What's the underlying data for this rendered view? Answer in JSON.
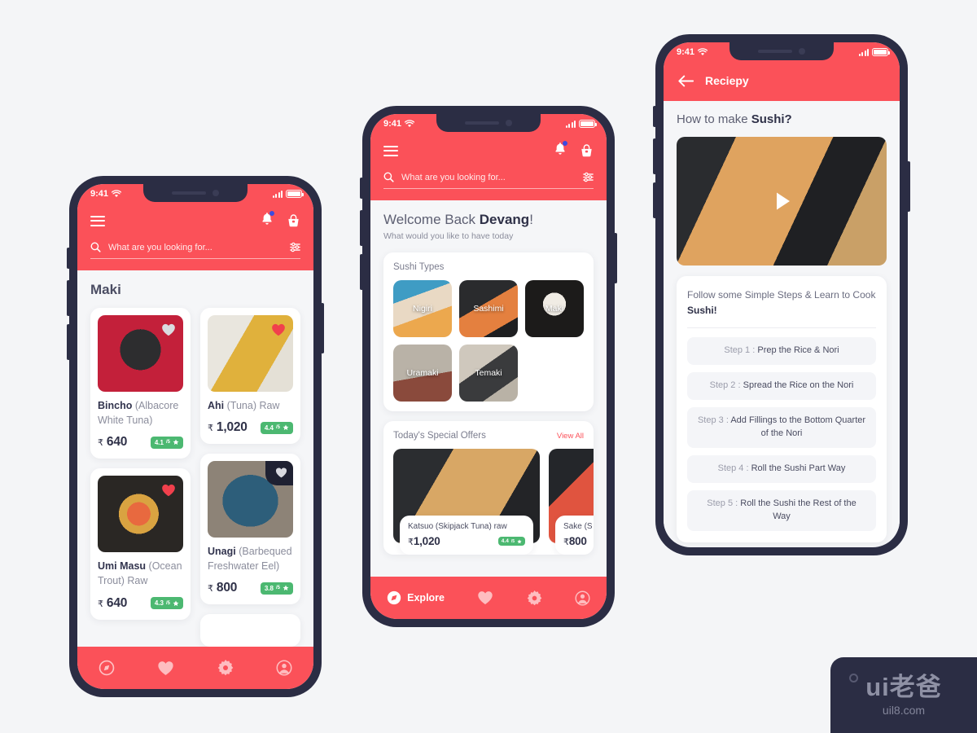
{
  "theme": {
    "accent": "#fb5159",
    "frame": "#2b2d44",
    "bg": "#f5f6f8",
    "rating_green": "#4cb871"
  },
  "status_bar": {
    "time": "9:41"
  },
  "search": {
    "placeholder": "What are you looking for..."
  },
  "phone1": {
    "section_title": "Maki",
    "products": [
      {
        "name": "Bincho",
        "desc": "(Albacore White Tuna)",
        "currency": "₹",
        "price": "640",
        "rating": "4.1",
        "rating_suffix": "/5",
        "favorite": false
      },
      {
        "name": "Ahi",
        "desc": "(Tuna) Raw",
        "currency": "₹",
        "price": "1,020",
        "rating": "4.4",
        "rating_suffix": "/5",
        "favorite": true
      },
      {
        "name": "Umi Masu",
        "desc": "(Ocean Trout) Raw",
        "currency": "₹",
        "price": "640",
        "rating": "4.3",
        "rating_suffix": "/5",
        "favorite": true
      },
      {
        "name": "Unagi",
        "desc": "(Barbequed Freshwater Eel)",
        "currency": "₹",
        "price": "800",
        "rating": "3.8",
        "rating_suffix": "/5",
        "favorite": false
      }
    ],
    "nav": [
      {
        "icon": "compass-icon",
        "label": "",
        "active": true
      },
      {
        "icon": "heart-icon",
        "label": "",
        "active": false
      },
      {
        "icon": "gear-icon",
        "label": "",
        "active": false
      },
      {
        "icon": "account-icon",
        "label": "",
        "active": false
      }
    ]
  },
  "phone2": {
    "welcome_prefix": "Welcome Back ",
    "welcome_name": "Devang",
    "welcome_suffix": "!",
    "welcome_sub": "What would you like to have today",
    "types_title": "Sushi Types",
    "types": [
      "Nigiri",
      "Sashimi",
      "Maki",
      "Uramaki",
      "Temaki"
    ],
    "offers_title": "Today's Special Offers",
    "offers_viewall": "View All",
    "offers": [
      {
        "name": "Katsuo (Skipjack Tuna) raw",
        "currency": "₹",
        "price": "1,020",
        "rating": "4.4",
        "rating_suffix": "/5"
      },
      {
        "name": "Sake (S",
        "currency": "₹",
        "price": "800",
        "rating": "",
        "rating_suffix": ""
      }
    ],
    "nav": [
      {
        "icon": "compass-icon",
        "label": "Explore",
        "active": true
      },
      {
        "icon": "heart-icon",
        "label": "",
        "active": false
      },
      {
        "icon": "gear-icon",
        "label": "",
        "active": false
      },
      {
        "icon": "account-icon",
        "label": "",
        "active": false
      }
    ]
  },
  "phone3": {
    "appbar_title": "Reciepy",
    "heading_prefix": "How to make ",
    "heading_bold": "Sushi?",
    "steps_intro_prefix": "Follow some Simple Steps & Learn to Cook ",
    "steps_intro_bold": "Sushi!",
    "steps": [
      {
        "label": "Step 1 : ",
        "text": "Prep the Rice & Nori"
      },
      {
        "label": "Step 2 : ",
        "text": "Spread the Rice on the Nori"
      },
      {
        "label": "Step 3 : ",
        "text": "Add Fillings to the Bottom Quarter of the Nori"
      },
      {
        "label": "Step 4 : ",
        "text": "Roll the Sushi Part Way"
      },
      {
        "label": "Step 5 : ",
        "text": "Roll the Sushi the Rest of the Way"
      }
    ]
  },
  "watermark": {
    "brand": "ui老爸",
    "url": "uil8.com"
  }
}
